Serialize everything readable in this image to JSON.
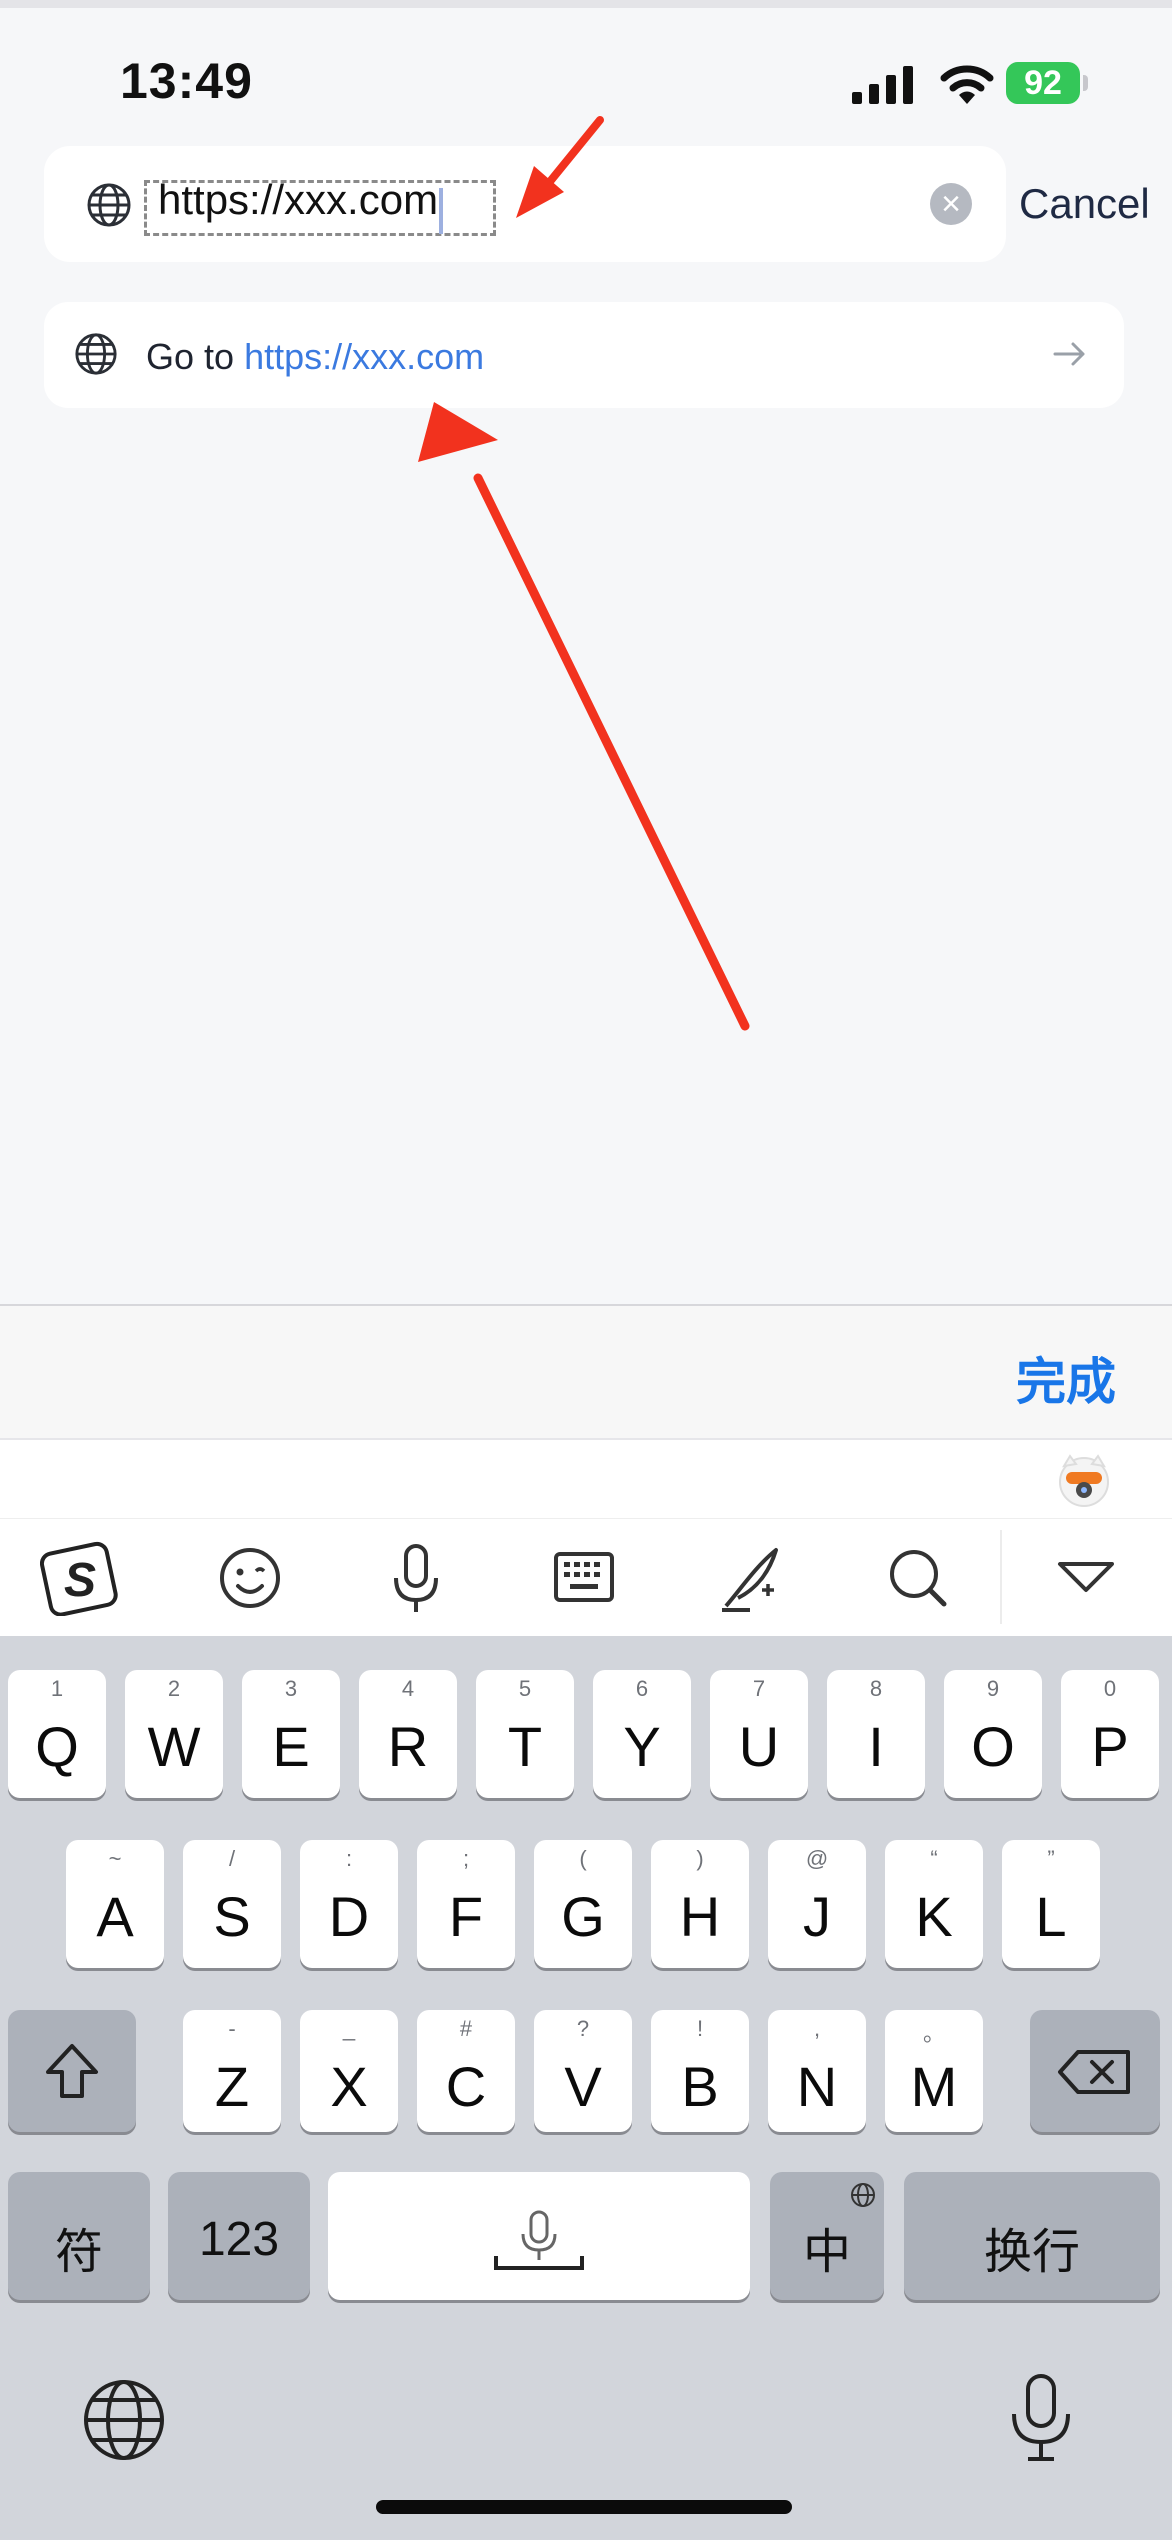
{
  "status": {
    "time": "13:49",
    "battery": "92"
  },
  "search": {
    "value": "https://xxx.com",
    "cancel_label": "Cancel"
  },
  "suggestion": {
    "prefix": "Go to",
    "url": "https://xxx.com"
  },
  "accessory": {
    "done_label": "完成"
  },
  "toolbar": {
    "icons": [
      "sogou-logo-icon",
      "emoji-icon",
      "microphone-icon",
      "keyboard-icon",
      "handwriting-icon",
      "search-icon",
      "collapse-icon"
    ]
  },
  "keyboard": {
    "row1": [
      {
        "key": "Q",
        "hint": "1"
      },
      {
        "key": "W",
        "hint": "2"
      },
      {
        "key": "E",
        "hint": "3"
      },
      {
        "key": "R",
        "hint": "4"
      },
      {
        "key": "T",
        "hint": "5"
      },
      {
        "key": "Y",
        "hint": "6"
      },
      {
        "key": "U",
        "hint": "7"
      },
      {
        "key": "I",
        "hint": "8"
      },
      {
        "key": "O",
        "hint": "9"
      },
      {
        "key": "P",
        "hint": "0"
      }
    ],
    "row2": [
      {
        "key": "A",
        "hint": "~"
      },
      {
        "key": "S",
        "hint": "/"
      },
      {
        "key": "D",
        "hint": ":"
      },
      {
        "key": "F",
        "hint": ";"
      },
      {
        "key": "G",
        "hint": "("
      },
      {
        "key": "H",
        "hint": ")"
      },
      {
        "key": "J",
        "hint": "@"
      },
      {
        "key": "K",
        "hint": "“"
      },
      {
        "key": "L",
        "hint": "”"
      }
    ],
    "row3": [
      {
        "key": "Z",
        "hint": "-"
      },
      {
        "key": "X",
        "hint": "_"
      },
      {
        "key": "C",
        "hint": "#"
      },
      {
        "key": "V",
        "hint": "?"
      },
      {
        "key": "B",
        "hint": "!"
      },
      {
        "key": "N",
        "hint": ","
      },
      {
        "key": "M",
        "hint": "。"
      }
    ],
    "symbols_label": "符",
    "numbers_label": "123",
    "chinese_label": "中",
    "return_label": "换行"
  },
  "colors": {
    "accent": "#1976e8",
    "link": "#3b7ae0",
    "annotation": "#f2321e"
  }
}
